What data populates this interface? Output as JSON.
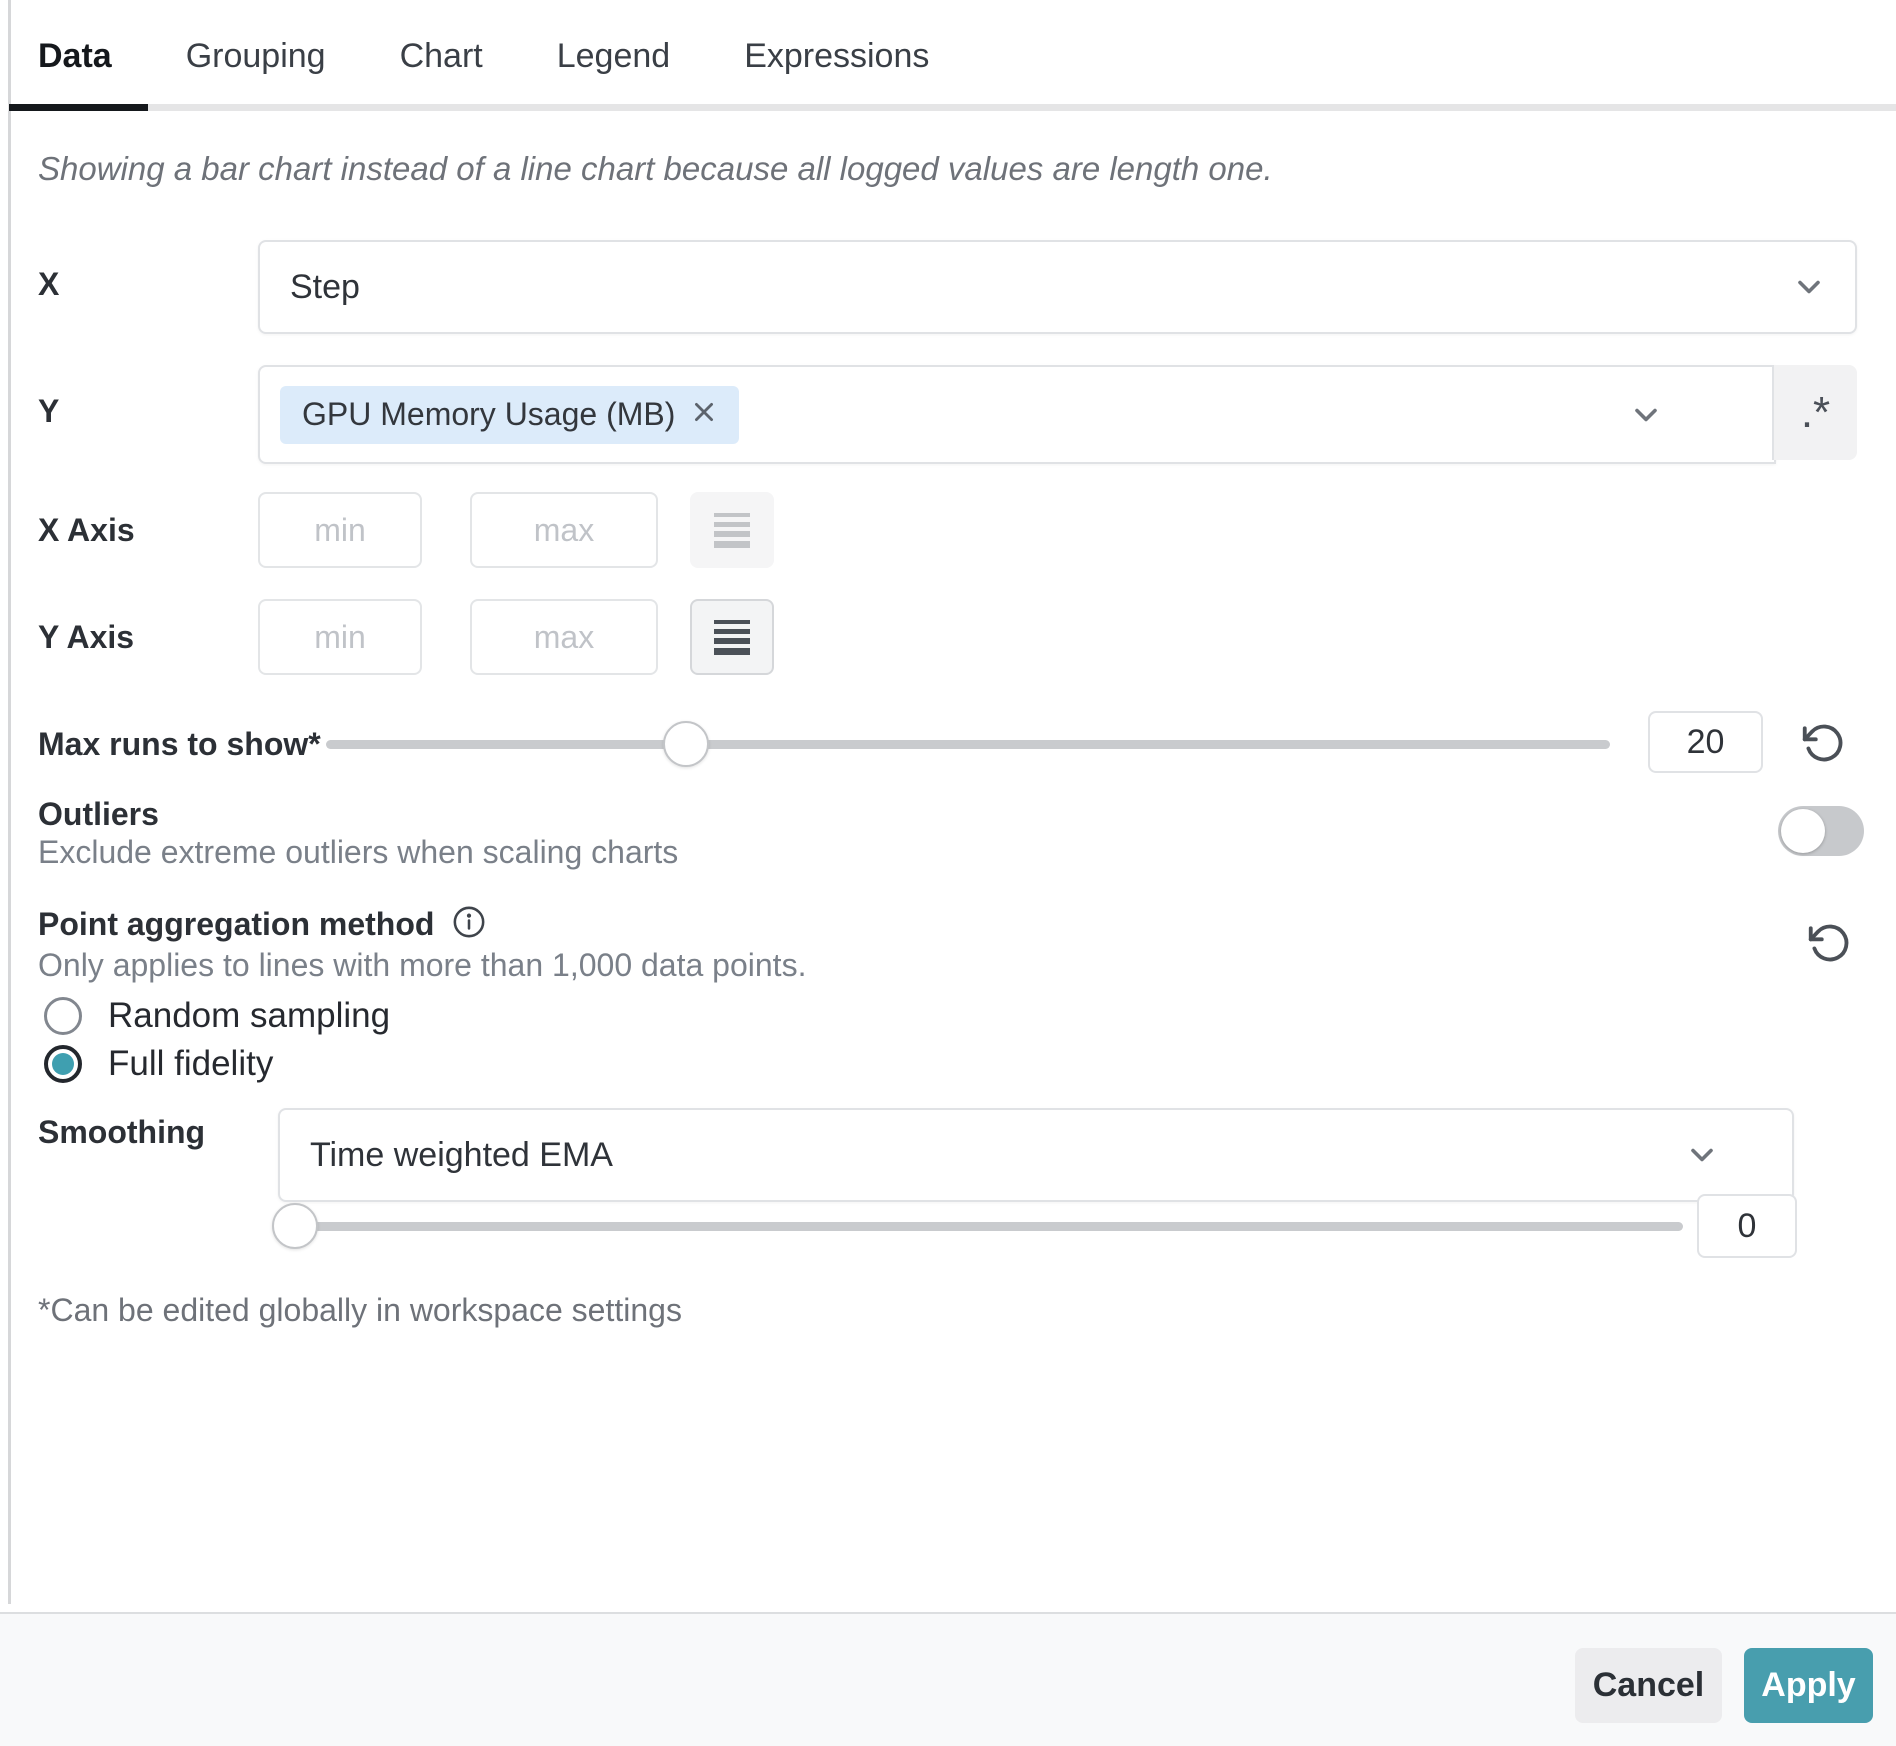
{
  "tabs": [
    {
      "label": "Data",
      "active": true
    },
    {
      "label": "Grouping",
      "active": false
    },
    {
      "label": "Chart",
      "active": false
    },
    {
      "label": "Legend",
      "active": false
    },
    {
      "label": "Expressions",
      "active": false
    }
  ],
  "notice": "Showing a bar chart instead of a line chart because all logged values are length one.",
  "fields": {
    "x": {
      "label": "X",
      "value": "Step"
    },
    "y": {
      "label": "Y",
      "tag": "GPU Memory Usage (MB)",
      "regex_button": ".*"
    },
    "x_axis": {
      "label": "X Axis",
      "min_placeholder": "min",
      "max_placeholder": "max"
    },
    "y_axis": {
      "label": "Y Axis",
      "min_placeholder": "min",
      "max_placeholder": "max"
    },
    "max_runs": {
      "label": "Max runs to show*",
      "value": "20"
    },
    "outliers": {
      "label": "Outliers",
      "description": "Exclude extreme outliers when scaling charts",
      "enabled": false
    },
    "point_aggregation": {
      "label": "Point aggregation method",
      "description": "Only applies to lines with more than 1,000 data points.",
      "options": [
        {
          "label": "Random sampling",
          "selected": false
        },
        {
          "label": "Full fidelity",
          "selected": true
        }
      ]
    },
    "smoothing": {
      "label": "Smoothing",
      "value": "Time weighted EMA",
      "slider_value": "0"
    }
  },
  "footnote": "*Can be edited globally in workspace settings",
  "footer": {
    "cancel_label": "Cancel",
    "apply_label": "Apply"
  },
  "colors": {
    "accent_teal": "#489eae",
    "radio_teal": "#3f9fb0",
    "tag_blue_bg": "#dcebfa",
    "track_gray": "#c9cbce"
  }
}
